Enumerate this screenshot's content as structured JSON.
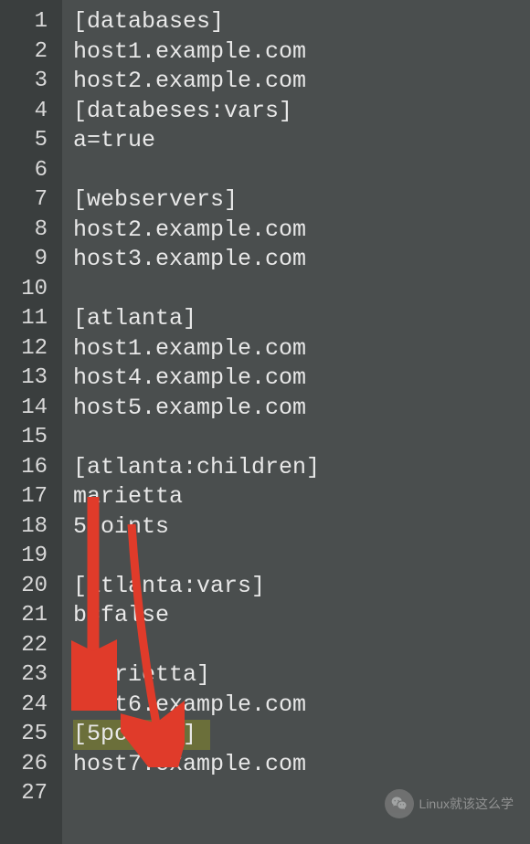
{
  "editor": {
    "lines": [
      {
        "num": 1,
        "text": "[databases]"
      },
      {
        "num": 2,
        "text": "host1.example.com"
      },
      {
        "num": 3,
        "text": "host2.example.com"
      },
      {
        "num": 4,
        "text": "[databeses:vars]"
      },
      {
        "num": 5,
        "text": "a=true"
      },
      {
        "num": 6,
        "text": ""
      },
      {
        "num": 7,
        "text": "[webservers]"
      },
      {
        "num": 8,
        "text": "host2.example.com"
      },
      {
        "num": 9,
        "text": "host3.example.com"
      },
      {
        "num": 10,
        "text": ""
      },
      {
        "num": 11,
        "text": "[atlanta]"
      },
      {
        "num": 12,
        "text": "host1.example.com"
      },
      {
        "num": 13,
        "text": "host4.example.com"
      },
      {
        "num": 14,
        "text": "host5.example.com"
      },
      {
        "num": 15,
        "text": ""
      },
      {
        "num": 16,
        "text": "[atlanta:children]"
      },
      {
        "num": 17,
        "text": "marietta"
      },
      {
        "num": 18,
        "text": "5points"
      },
      {
        "num": 19,
        "text": ""
      },
      {
        "num": 20,
        "text": "[atlanta:vars]"
      },
      {
        "num": 21,
        "text": "b=false"
      },
      {
        "num": 22,
        "text": ""
      },
      {
        "num": 23,
        "text": "[marietta]"
      },
      {
        "num": 24,
        "text": "host6.example.com"
      },
      {
        "num": 25,
        "text": "[5points]",
        "highlighted": true,
        "cursor": true
      },
      {
        "num": 26,
        "text": "host7.example.com"
      },
      {
        "num": 27,
        "text": ""
      }
    ]
  },
  "annotations": {
    "arrows": [
      {
        "from": "marietta-line17",
        "to": "marietta-line23",
        "color": "#e03b2a"
      },
      {
        "from": "5points-line18",
        "to": "5points-line25",
        "color": "#e03b2a"
      }
    ]
  },
  "watermark": {
    "text": "Linux就该这么学",
    "icon": "wechat-icon"
  }
}
